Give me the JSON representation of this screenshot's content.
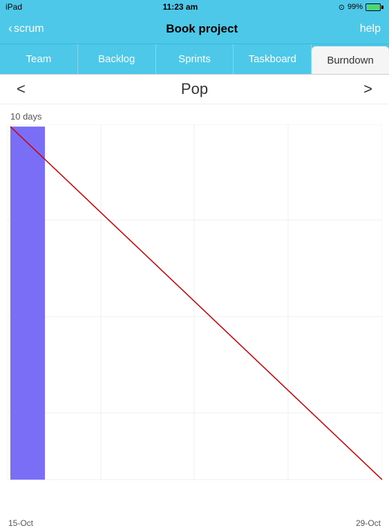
{
  "statusBar": {
    "device": "iPad",
    "time": "11:23 am",
    "signal": "●",
    "battery": "99%"
  },
  "navBar": {
    "backLabel": "scrum",
    "title": "Book project",
    "helpLabel": "help"
  },
  "tabs": [
    {
      "id": "team",
      "label": "Team",
      "active": false
    },
    {
      "id": "backlog",
      "label": "Backlog",
      "active": false
    },
    {
      "id": "sprints",
      "label": "Sprints",
      "active": false
    },
    {
      "id": "taskboard",
      "label": "Taskboard",
      "active": false
    },
    {
      "id": "burndown",
      "label": "Burndown",
      "active": true
    }
  ],
  "sprintNav": {
    "prevArrow": "<",
    "nextArrow": ">",
    "sprintName": "Pop"
  },
  "chart": {
    "daysLabel": "10 days",
    "xAxisStart": "15-Oct",
    "xAxisEnd": "29-Oct",
    "barColor": "#7b6ef6",
    "lineColor": "#cc0000"
  }
}
